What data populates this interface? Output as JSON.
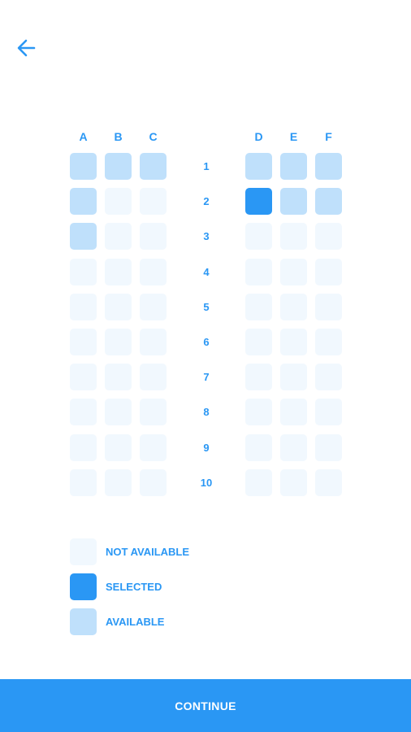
{
  "header": {
    "back_icon": "arrow-left-icon"
  },
  "seatmap": {
    "left_columns": [
      "A",
      "B",
      "C"
    ],
    "right_columns": [
      "D",
      "E",
      "F"
    ],
    "rows": [
      {
        "number": "1",
        "seats": [
          "available",
          "available",
          "available",
          "available",
          "available",
          "available"
        ]
      },
      {
        "number": "2",
        "seats": [
          "available",
          "not_available",
          "not_available",
          "selected",
          "available",
          "available"
        ]
      },
      {
        "number": "3",
        "seats": [
          "available",
          "not_available",
          "not_available",
          "not_available",
          "not_available",
          "not_available"
        ]
      },
      {
        "number": "4",
        "seats": [
          "not_available",
          "not_available",
          "not_available",
          "not_available",
          "not_available",
          "not_available"
        ]
      },
      {
        "number": "5",
        "seats": [
          "not_available",
          "not_available",
          "not_available",
          "not_available",
          "not_available",
          "not_available"
        ]
      },
      {
        "number": "6",
        "seats": [
          "not_available",
          "not_available",
          "not_available",
          "not_available",
          "not_available",
          "not_available"
        ]
      },
      {
        "number": "7",
        "seats": [
          "not_available",
          "not_available",
          "not_available",
          "not_available",
          "not_available",
          "not_available"
        ]
      },
      {
        "number": "8",
        "seats": [
          "not_available",
          "not_available",
          "not_available",
          "not_available",
          "not_available",
          "not_available"
        ]
      },
      {
        "number": "9",
        "seats": [
          "not_available",
          "not_available",
          "not_available",
          "not_available",
          "not_available",
          "not_available"
        ]
      },
      {
        "number": "10",
        "seats": [
          "not_available",
          "not_available",
          "not_available",
          "not_available",
          "not_available",
          "not_available"
        ]
      }
    ]
  },
  "legend": {
    "items": [
      {
        "label": "NOT AVAILABLE",
        "status": "not_available"
      },
      {
        "label": "SELECTED",
        "status": "selected"
      },
      {
        "label": "AVAILABLE",
        "status": "available"
      }
    ]
  },
  "footer": {
    "continue_label": "CONTINUE"
  },
  "colors": {
    "accent": "#2a97f4",
    "available": "#bfe0fb",
    "not_available": "#f1f8fe",
    "selected": "#2a97f4",
    "background": "#ffffff"
  }
}
